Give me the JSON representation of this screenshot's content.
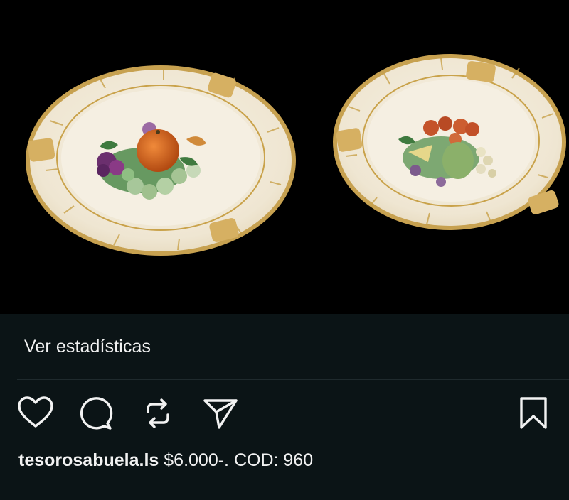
{
  "post": {
    "image_alt": "Dos ceniceros de porcelana con decoración de frutas y borde dorado",
    "stats_label": "Ver estadísticas",
    "username": "tesorosabuela.ls",
    "caption_text": " $6.000-. COD: 960"
  },
  "actions": {
    "like_icon": "heart-icon",
    "comment_icon": "comment-icon",
    "repost_icon": "repost-icon",
    "share_icon": "send-icon",
    "save_icon": "bookmark-icon"
  },
  "colors": {
    "background": "#0b1416",
    "photo_background": "#000000",
    "text": "#f2f2f2",
    "gold_rim": "#c9a24a",
    "porcelain": "#f3ecdc"
  }
}
